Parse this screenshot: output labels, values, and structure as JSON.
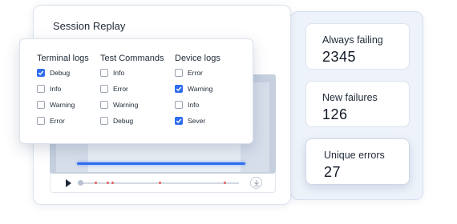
{
  "stats": [
    {
      "label": "Always failing",
      "value": "2345"
    },
    {
      "label": "New failures",
      "value": "126"
    },
    {
      "label": "Unique errors",
      "value": "27"
    }
  ],
  "session": {
    "title": "Session Replay"
  },
  "filters": {
    "columns": [
      {
        "heading": "Terminal logs",
        "options": [
          {
            "label": "Debug",
            "checked": true
          },
          {
            "label": "Info",
            "checked": false
          },
          {
            "label": "Warning",
            "checked": false
          },
          {
            "label": "Error",
            "checked": false
          }
        ]
      },
      {
        "heading": "Test Commands",
        "options": [
          {
            "label": "Info",
            "checked": false
          },
          {
            "label": "Error",
            "checked": false
          },
          {
            "label": "Warning",
            "checked": false
          },
          {
            "label": "Debug",
            "checked": false
          }
        ]
      },
      {
        "heading": "Device logs",
        "options": [
          {
            "label": "Error",
            "checked": false
          },
          {
            "label": "Warning",
            "checked": true
          },
          {
            "label": "Info",
            "checked": false
          },
          {
            "label": "Sever",
            "checked": true
          }
        ]
      }
    ]
  },
  "player": {
    "progress": 0,
    "accent": "#2f6cf0",
    "marker_color": "#e46060"
  }
}
